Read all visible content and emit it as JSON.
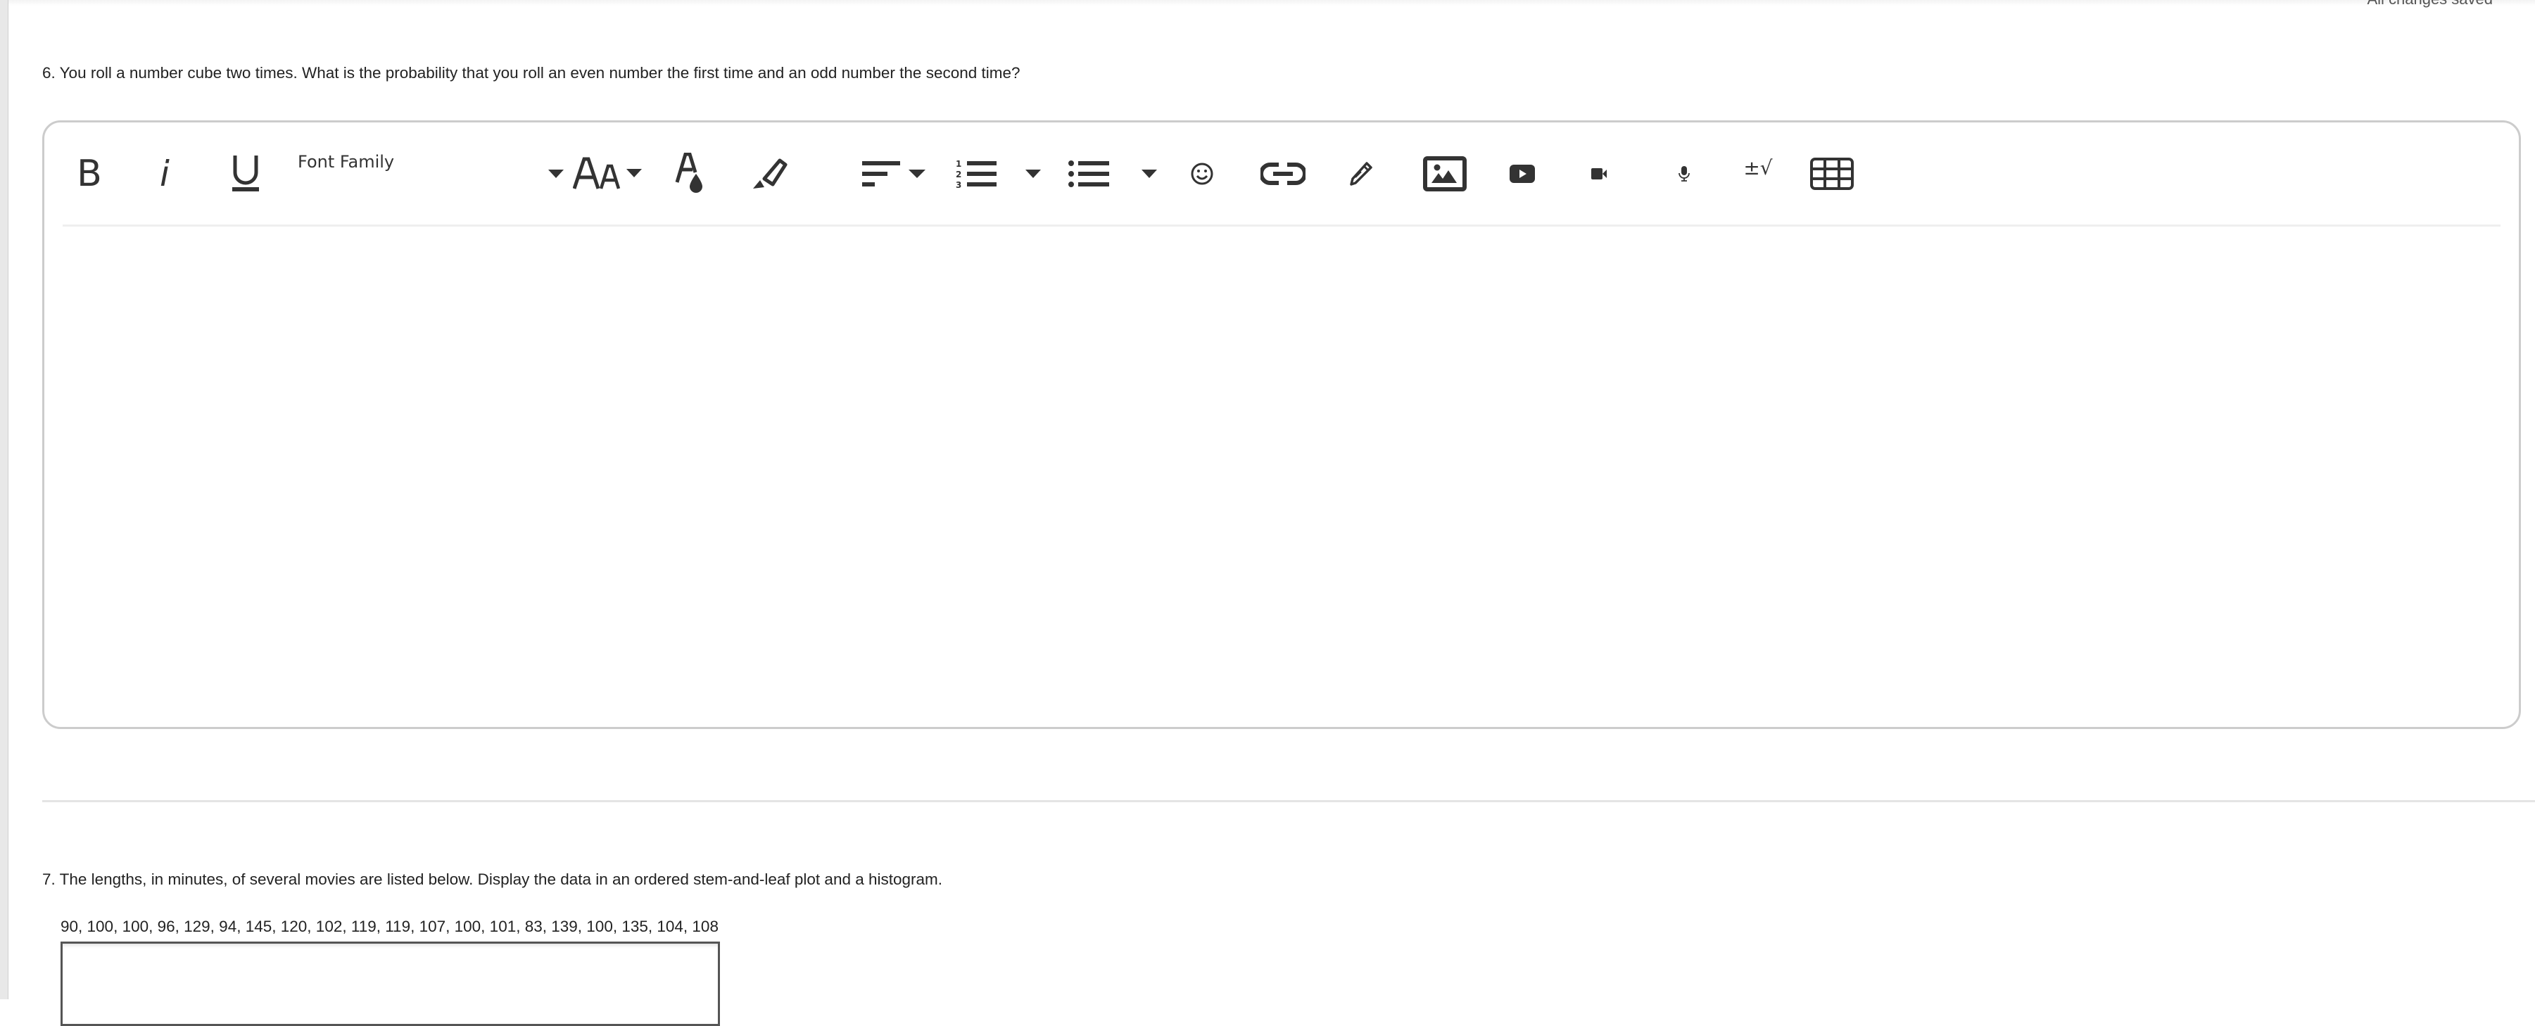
{
  "status": {
    "save_state": "All changes saved"
  },
  "questions": [
    {
      "number": 6,
      "text": "6. You roll a number cube two times. What is the probability that you roll an even number the first time and an odd number the second time?",
      "editor": {
        "toolbar": {
          "font_family_label": "Font Family",
          "buttons": [
            {
              "name": "bold",
              "icon": "bold-icon",
              "glyph": "B"
            },
            {
              "name": "italic",
              "icon": "italic-icon",
              "glyph": "i"
            },
            {
              "name": "underline",
              "icon": "underline-icon",
              "glyph": "U"
            },
            {
              "name": "font-family",
              "icon": "chevron-down-icon"
            },
            {
              "name": "font-size",
              "icon": "font-size-icon",
              "glyph": "AA"
            },
            {
              "name": "text-color",
              "icon": "text-color-icon"
            },
            {
              "name": "highlight",
              "icon": "highlighter-icon"
            },
            {
              "name": "align",
              "icon": "align-left-icon"
            },
            {
              "name": "numbered-list",
              "icon": "numbered-list-icon"
            },
            {
              "name": "bullet-list",
              "icon": "bullet-list-icon"
            },
            {
              "name": "emoji",
              "icon": "emoji-icon"
            },
            {
              "name": "link",
              "icon": "link-icon"
            },
            {
              "name": "draw",
              "icon": "pencil-icon"
            },
            {
              "name": "image",
              "icon": "image-icon"
            },
            {
              "name": "youtube",
              "icon": "youtube-icon"
            },
            {
              "name": "video",
              "icon": "video-camera-icon"
            },
            {
              "name": "audio",
              "icon": "microphone-icon"
            },
            {
              "name": "math",
              "icon": "math-equation-icon",
              "glyph": "±√"
            },
            {
              "name": "table",
              "icon": "table-icon"
            }
          ]
        },
        "content": ""
      }
    },
    {
      "number": 7,
      "text": "7. The lengths, in minutes, of several movies are listed below. Display the data in an ordered stem-and-leaf plot and a histogram.",
      "data_line": "90, 100, 100, 96, 129, 94, 145, 120, 102, 119, 119, 107, 100, 101, 83, 139, 100, 135, 104, 108",
      "answer": ""
    }
  ],
  "colors": {
    "icon": "#333333",
    "border": "#cccccc",
    "divider": "#e4e4e4"
  }
}
